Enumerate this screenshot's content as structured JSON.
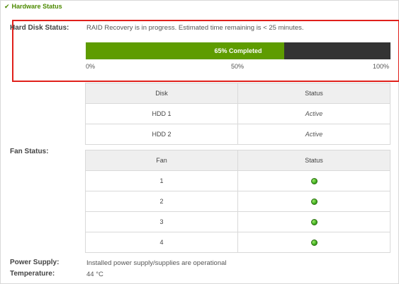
{
  "section": {
    "title": "Hardware Status"
  },
  "hard_disk": {
    "label": "Hard Disk Status:",
    "message": "RAID Recovery is in progress. Estimated time remaining is < 25 minutes.",
    "progress": {
      "percent": 65,
      "label": "65% Completed",
      "ticks": [
        "0%",
        "50%",
        "100%"
      ]
    },
    "table": {
      "headers": [
        "Disk",
        "Status"
      ],
      "rows": [
        [
          "HDD 1",
          "Active"
        ],
        [
          "HDD 2",
          "Active"
        ]
      ]
    }
  },
  "fan": {
    "label": "Fan Status:",
    "table": {
      "headers": [
        "Fan",
        "Status"
      ],
      "rows": [
        [
          "1",
          "green-dot-icon"
        ],
        [
          "2",
          "green-dot-icon"
        ],
        [
          "3",
          "green-dot-icon"
        ],
        [
          "4",
          "green-dot-icon"
        ]
      ]
    }
  },
  "power": {
    "label": "Power Supply:",
    "value": "Installed power supply/supplies are operational"
  },
  "temperature": {
    "label": "Temperature:",
    "value": "44 °C"
  },
  "colors": {
    "accent": "#5e9c00",
    "highlight": "#e0201b",
    "bar_bg": "#333333"
  }
}
